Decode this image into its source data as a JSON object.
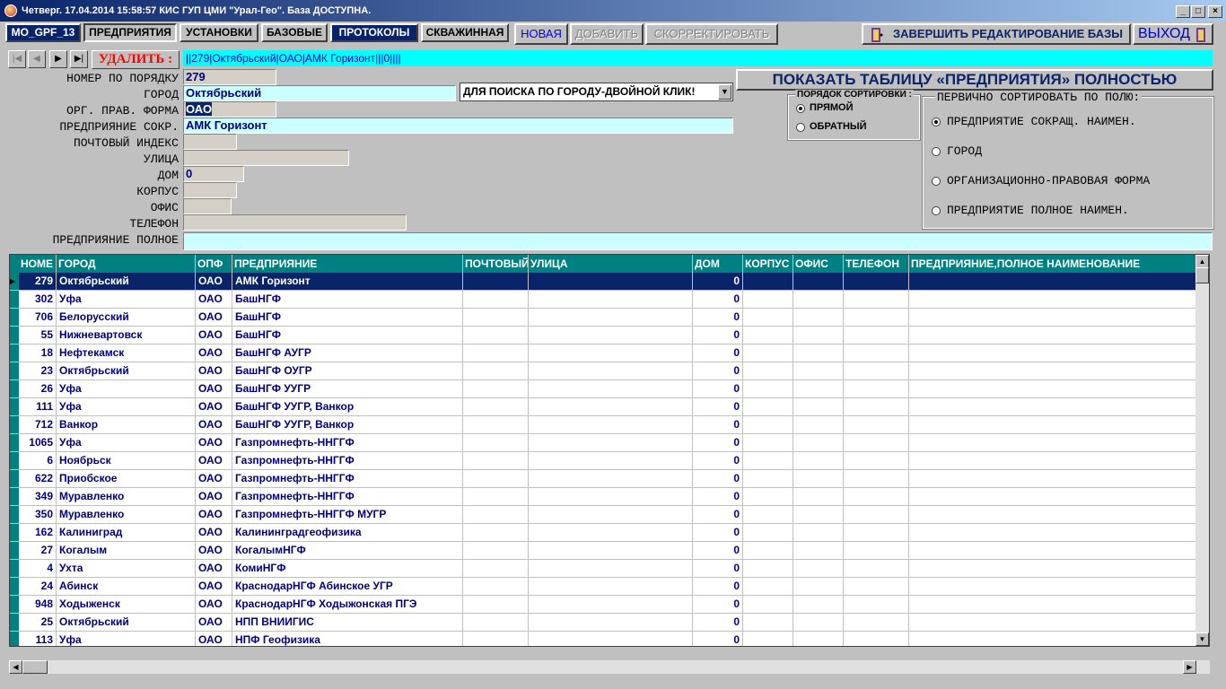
{
  "window": {
    "title": "Четверг. 17.04.2014 15:58:57  КИС ГУП ЦМИ \"Урал-Гео\". База ДОСТУПНА."
  },
  "tabs": [
    "MO_GPF_13",
    "ПРЕДПРИЯТИЯ",
    "УСТАНОВКИ",
    "БАЗОВЫЕ",
    "ПРОТОКОЛЫ",
    "СКВАЖИННАЯ"
  ],
  "toolbar": {
    "new": "НОВАЯ",
    "add": "ДОБАВИТЬ",
    "correct": "СКОРРЕКТИРОВАТЬ",
    "finish": "ЗАВЕРШИТЬ РЕДАКТИРОВАНИЕ БАЗЫ",
    "exit": "ВЫХОД"
  },
  "delete_label": "УДАЛИТЬ :",
  "record_summary": "||279|Октябрьский|ОАО|АМК Горизонт|||0||||",
  "form": {
    "labels": [
      "НОМЕР ПО ПОРЯДКУ",
      "ГОРОД",
      "ОРГ. ПРАВ. ФОРМА",
      "ПРЕДПРИЯНИЕ СОКР.",
      "ПОЧТОВЫЙ ИНДЕКС",
      "УЛИЦА",
      "ДОМ",
      "КОРПУС",
      "ОФИС",
      "ТЕЛЕФОН",
      "ПРЕДПРИЯНИЕ ПОЛНОЕ"
    ],
    "values": {
      "number": "279",
      "city": "Октябрьский",
      "form": "ОАО",
      "short_name": "АМК Горизонт",
      "house": "0"
    },
    "city_search": "ДЛЯ ПОИСКА ПО ГОРОДУ-ДВОЙНОЙ КЛИК!"
  },
  "show_table_button": "ПОКАЗАТЬ ТАБЛИЦУ «ПРЕДПРИЯТИЯ» ПОЛНОСТЬЮ",
  "sort_order": {
    "title": "ПОРЯДОК СОРТИРОВКИ :",
    "options": [
      "ПРЯМОЙ",
      "ОБРАТНЫЙ"
    ],
    "selected": 0
  },
  "primary_sort": {
    "title": "ПЕРВИЧНО СОРТИРОВАТЬ ПО ПОЛЮ:",
    "options": [
      "ПРЕДПРИЯТИЕ СОКРАЩ. НАИМЕН.",
      "ГОРОД",
      "ОРГАНИЗАЦИОННО-ПРАВОВАЯ ФОРМА",
      "ПРЕДПРИЯТИЕ ПОЛНОЕ  НАИМЕН."
    ],
    "selected": 0
  },
  "grid": {
    "columns": [
      "НОМЕ",
      "ГОРОД",
      "ОПФ",
      "ПРЕДПРИЯНИЕ",
      "ПОЧТОВЫЙ",
      "УЛИЦА",
      "ДОМ",
      "КОРПУС",
      "ОФИС",
      "ТЕЛЕФОН",
      "ПРЕДПРИЯНИЕ,ПОЛНОЕ НАИМЕНОВАНИЕ"
    ],
    "rows": [
      [
        "279",
        "Октябрьский",
        "ОАО",
        "АМК Горизонт",
        "0"
      ],
      [
        "302",
        "Уфа",
        "ОАО",
        "БашНГФ",
        "0"
      ],
      [
        "706",
        "Белорусский",
        "ОАО",
        "БашНГФ",
        "0"
      ],
      [
        "55",
        "Нижневартовск",
        "ОАО",
        "БашНГФ",
        "0"
      ],
      [
        "18",
        "Нефтекамск",
        "ОАО",
        "БашНГФ АУГР",
        "0"
      ],
      [
        "23",
        "Октябрьский",
        "ОАО",
        "БашНГФ ОУГР",
        "0"
      ],
      [
        "26",
        "Уфа",
        "ОАО",
        "БашНГФ УУГР",
        "0"
      ],
      [
        "111",
        "Уфа",
        "ОАО",
        "БашНГФ УУГР, Ванкор",
        "0"
      ],
      [
        "712",
        "Ванкор",
        "ОАО",
        "БашНГФ УУГР, Ванкор",
        "0"
      ],
      [
        "1065",
        "Уфа",
        "ОАО",
        "Газпромнефть-ННГГФ",
        "0"
      ],
      [
        "6",
        "Ноябрьск",
        "ОАО",
        "Газпромнефть-ННГГФ",
        "0"
      ],
      [
        "622",
        "Приобское",
        "ОАО",
        "Газпромнефть-ННГГФ",
        "0"
      ],
      [
        "349",
        "Муравленко",
        "ОАО",
        "Газпромнефть-ННГГФ",
        "0"
      ],
      [
        "350",
        "Муравленко",
        "ОАО",
        "Газпромнефть-ННГГФ МУГР",
        "0"
      ],
      [
        "162",
        "Калиниград",
        "ОАО",
        "Калининградгеофизика",
        "0"
      ],
      [
        "27",
        "Когалым",
        "ОАО",
        "КогалымНГФ",
        "0"
      ],
      [
        "4",
        "Ухта",
        "ОАО",
        "КомиНГФ",
        "0"
      ],
      [
        "24",
        "Абинск",
        "ОАО",
        "КраснодарНГФ Абинское УГР",
        "0"
      ],
      [
        "948",
        "Ходыженск",
        "ОАО",
        "КраснодарНГФ Ходыжонская ПГЭ",
        "0"
      ],
      [
        "25",
        "Октябрьский",
        "ОАО",
        "НПП ВНИИГИС",
        "0"
      ],
      [
        "113",
        "Уфа",
        "ОАО",
        "НПФ Геофизика",
        "0"
      ]
    ],
    "selected_row": 0
  },
  "colors": {
    "titlebar": "#0a246a",
    "grid_header": "#008080",
    "selection": "#0a246a",
    "summary_bg": "#00ffff"
  }
}
